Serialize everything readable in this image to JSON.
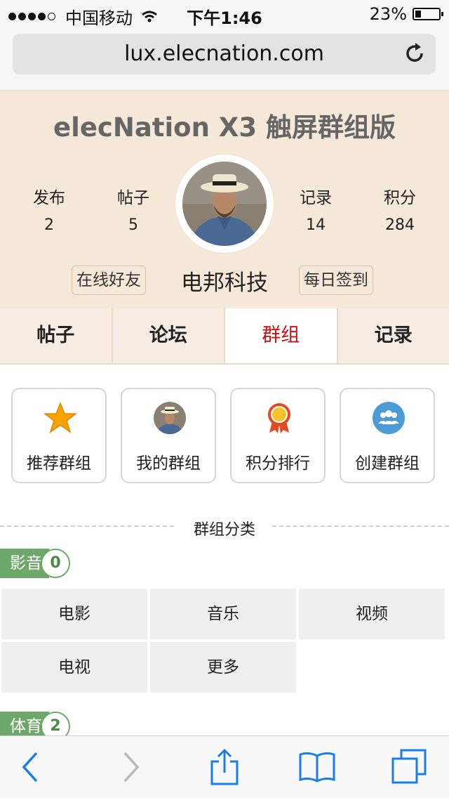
{
  "status_bar": {
    "carrier": "中国移动",
    "time": "下午1:46",
    "battery": "23%"
  },
  "url_bar": {
    "url": "lux.elecnation.com"
  },
  "profile": {
    "site_title": "elecNation X3 触屏群组版",
    "stats": [
      {
        "label": "发布",
        "value": "2"
      },
      {
        "label": "帖子",
        "value": "5"
      },
      {
        "label": "记录",
        "value": "14"
      },
      {
        "label": "积分",
        "value": "284"
      }
    ],
    "online_friends_label": "在线好友",
    "username": "电邦科技",
    "daily_checkin_label": "每日签到"
  },
  "tabs": [
    {
      "label": "帖子"
    },
    {
      "label": "论坛"
    },
    {
      "label": "群组",
      "active": true
    },
    {
      "label": "记录"
    }
  ],
  "tiles": [
    {
      "label": "推荐群组",
      "icon": "star-icon"
    },
    {
      "label": "我的群组",
      "icon": "avatar-icon"
    },
    {
      "label": "积分排行",
      "icon": "medal-icon"
    },
    {
      "label": "创建群组",
      "icon": "group-icon"
    }
  ],
  "section": {
    "title": "群组分类"
  },
  "categories": [
    {
      "name": "影音",
      "count": "0",
      "items": [
        "电影",
        "音乐",
        "视频",
        "电视",
        "更多"
      ]
    },
    {
      "name": "体育",
      "count": "2",
      "items": []
    }
  ],
  "colors": {
    "accent": "#cc1111",
    "header_bg": "#f7e9da",
    "category_green": "#6da86a",
    "ios_blue": "#1a7ee6"
  }
}
